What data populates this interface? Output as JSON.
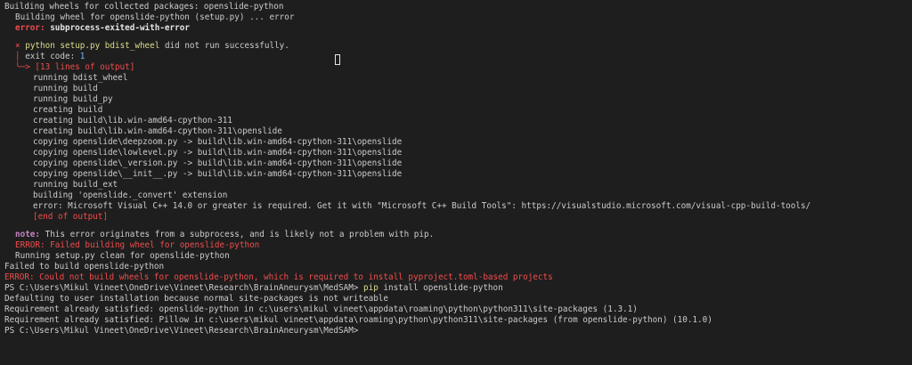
{
  "terminal": {
    "lines": {
      "l1": "Building wheels for collected packages: openslide-python",
      "l2": "Building wheel for openslide-python (setup.py) ... error",
      "l3_label": "error:",
      "l3_text": " subprocess-exited-with-error",
      "l4_mark": "×",
      "l4_cmd": "python setup.py bdist_wheel",
      "l4_text": " did not run successfully.",
      "l5_bar": "│",
      "l5_text": " exit code: ",
      "l5_code": "1",
      "l6_arrow": "╰─>",
      "l6_text": " [13 lines of output]",
      "l7": "running bdist_wheel",
      "l8": "running build",
      "l9": "running build_py",
      "l10": "creating build",
      "l11": "creating build\\lib.win-amd64-cpython-311",
      "l12": "creating build\\lib.win-amd64-cpython-311\\openslide",
      "l13": "copying openslide\\deepzoom.py -> build\\lib.win-amd64-cpython-311\\openslide",
      "l14": "copying openslide\\lowlevel.py -> build\\lib.win-amd64-cpython-311\\openslide",
      "l15": "copying openslide\\_version.py -> build\\lib.win-amd64-cpython-311\\openslide",
      "l16": "copying openslide\\__init__.py -> build\\lib.win-amd64-cpython-311\\openslide",
      "l17": "running build_ext",
      "l18": "building 'openslide._convert' extension",
      "l19": "error: Microsoft Visual C++ 14.0 or greater is required. Get it with \"Microsoft C++ Build Tools\": https://visualstudio.microsoft.com/visual-cpp-build-tools/",
      "l20": "[end of output]",
      "l22_label": "note:",
      "l22_text": " This error originates from a subprocess, and is likely not a problem with pip.",
      "l23": "ERROR: Failed building wheel for openslide-python",
      "l24": "Running setup.py clean for openslide-python",
      "l25": "Failed to build openslide-python",
      "l26": "ERROR: Could not build wheels for openslide-python, which is required to install pyproject.toml-based projects",
      "l27_prompt": "PS C:\\Users\\Mikul Vineet\\OneDrive\\Vineet\\Research\\BrainAneurysm\\MedSAM>",
      "l27_pip": " pip",
      "l27_args": " install openslide-python",
      "l28": "Defaulting to user installation because normal site-packages is not writeable",
      "l29": "Requirement already satisfied: openslide-python in c:\\users\\mikul vineet\\appdata\\roaming\\python\\python311\\site-packages (1.3.1)",
      "l30": "Requirement already satisfied: Pillow in c:\\users\\mikul vineet\\appdata\\roaming\\python\\python311\\site-packages (from openslide-python) (10.1.0)",
      "l31_prompt": "PS C:\\Users\\Mikul Vineet\\OneDrive\\Vineet\\Research\\BrainAneurysm\\MedSAM>"
    }
  },
  "colors": {
    "background": "#1e1e1e",
    "foreground": "#cccccc",
    "error": "#f14c4c",
    "note": "#c586c0",
    "command": "#dcdc8b"
  },
  "icons": {
    "cursor": "text-cursor-icon"
  }
}
